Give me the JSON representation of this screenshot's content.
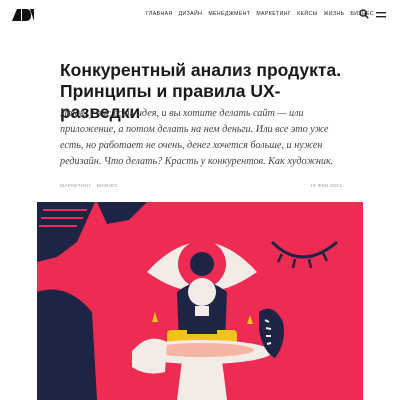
{
  "header": {
    "logo_name": "ADN logo",
    "nav": [
      "Главная",
      "Дизайн",
      "Менеджмент",
      "Маркетинг",
      "Кейсы",
      "Жизнь",
      "Бизнес"
    ],
    "icons": [
      "search-icon",
      "menu-icon"
    ]
  },
  "article": {
    "title_line1": "Конкурентный анализ продукта.",
    "title_line2": "Принципы и правила UX-разведки",
    "lead": "Итак, у вас есть идея, и вы хотите делать сайт — или приложение, а потом делать на нем деньги. Или все это уже есть, но работает не очень, денег хочется больше, и нужен редизайн. Что делать? Красть у конкурентов. Как художник.",
    "tags": "Маркетинг · Бизнес",
    "date": "19 фев 2021"
  },
  "colors": {
    "hero_background": "#ee2b52",
    "hero_dark": "#1d2446",
    "hero_yellow": "#f0c21c",
    "hero_light": "#f3ece6"
  }
}
